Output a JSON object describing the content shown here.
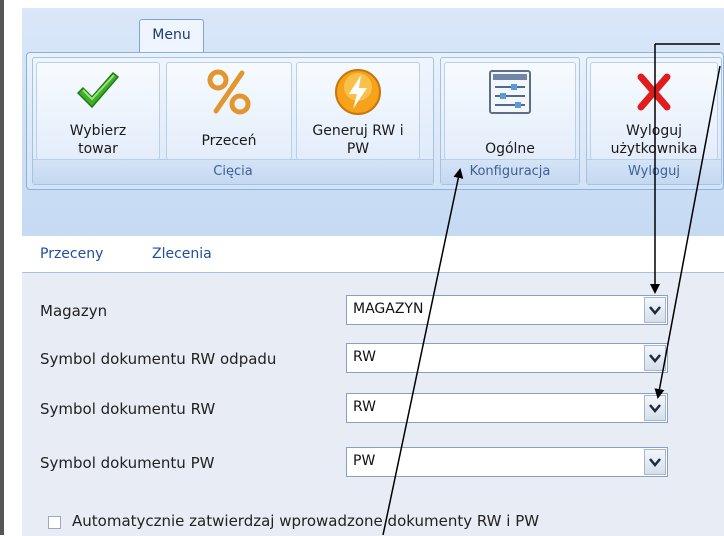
{
  "ribbon": {
    "tab_label": "Menu",
    "groups": [
      {
        "label": "Cięcia"
      },
      {
        "label": "Konfiguracja"
      },
      {
        "label": "Wyloguj"
      }
    ],
    "buttons": {
      "wybierz": {
        "line1": "Wybierz",
        "line2": "towar",
        "icon": "checkmark-icon"
      },
      "przecen": {
        "line1": "Przeceń",
        "icon": "percent-icon"
      },
      "generuj": {
        "line1": "Generuj RW i",
        "line2": "PW",
        "icon": "lightning-icon"
      },
      "ogolne": {
        "line1": "Ogólne",
        "icon": "settings-sliders-icon"
      },
      "wyloguj": {
        "line1": "Wyloguj",
        "line2": "użytkownika",
        "icon": "red-x-icon"
      }
    }
  },
  "tabs": [
    "Przeceny",
    "Zlecenia"
  ],
  "form": {
    "fields": [
      {
        "label": "Magazyn",
        "value": "MAGAZYN"
      },
      {
        "label": "Symbol dokumentu RW odpadu",
        "value": "RW"
      },
      {
        "label": "Symbol dokumentu RW",
        "value": "RW"
      },
      {
        "label": "Symbol dokumentu PW",
        "value": "PW"
      }
    ],
    "checkbox_label": "Automatycznie zatwierdzaj wprowadzone dokumenty RW i PW",
    "checkbox_checked": false
  },
  "colors": {
    "ribbon_bg": "#d9e7f8",
    "tab_text": "#1e4fa0",
    "form_bg": "#e7ecf5"
  }
}
